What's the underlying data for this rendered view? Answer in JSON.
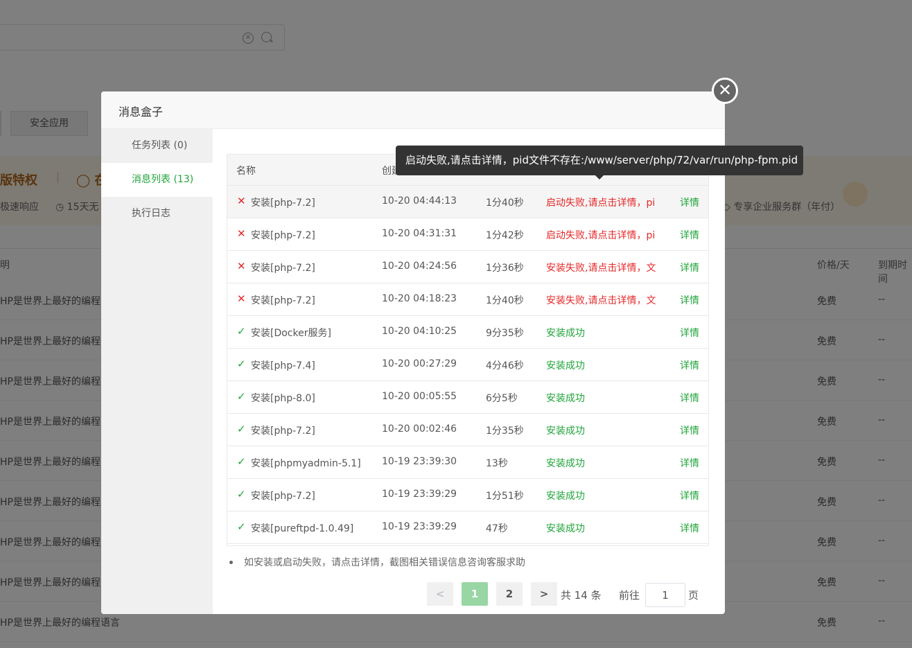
{
  "background": {
    "buttons": [
      "安全应用"
    ],
    "banner_title_1": "版特权",
    "banner_title_2": "在",
    "banner_sub": [
      "极速响应",
      "15天无",
      "专享企业服务群（年付）"
    ],
    "col_headers": {
      "desc": "明",
      "price": "价格/天",
      "expire": "到期时间"
    },
    "row_desc": "HP是世界上最好的编程",
    "row_desc_last": "HP是世界上最好的编程语言",
    "row_price": "免费",
    "row_expire": "--"
  },
  "dialog": {
    "title": "消息盒子",
    "close_icon": "close-icon",
    "sidebar": [
      {
        "label": "任务列表 (0)",
        "active": false
      },
      {
        "label": "消息列表 (13)",
        "active": true
      },
      {
        "label": "执行日志",
        "active": false
      }
    ],
    "table": {
      "headers": {
        "name": "名称",
        "created": "创建"
      },
      "rows": [
        {
          "status_icon": "error",
          "name": "安装[php-7.2]",
          "time": "10-20 04:44:13",
          "duration": "1分40秒",
          "state": "启动失败,请点击详情，pi",
          "detail": "详情"
        },
        {
          "status_icon": "error",
          "name": "安装[php-7.2]",
          "time": "10-20 04:31:31",
          "duration": "1分42秒",
          "state": "启动失败,请点击详情，pi",
          "detail": "详情"
        },
        {
          "status_icon": "error",
          "name": "安装[php-7.2]",
          "time": "10-20 04:24:56",
          "duration": "1分36秒",
          "state": "安装失败,请点击详情，文",
          "detail": "详情"
        },
        {
          "status_icon": "error",
          "name": "安装[php-7.2]",
          "time": "10-20 04:18:23",
          "duration": "1分40秒",
          "state": "安装失败,请点击详情，文",
          "detail": "详情"
        },
        {
          "status_icon": "success",
          "name": "安装[Docker服务]",
          "time": "10-20 04:10:25",
          "duration": "9分35秒",
          "state": "安装成功",
          "detail": "详情"
        },
        {
          "status_icon": "success",
          "name": "安装[php-7.4]",
          "time": "10-20 00:27:29",
          "duration": "4分46秒",
          "state": "安装成功",
          "detail": "详情"
        },
        {
          "status_icon": "success",
          "name": "安装[php-8.0]",
          "time": "10-20 00:05:55",
          "duration": "6分5秒",
          "state": "安装成功",
          "detail": "详情"
        },
        {
          "status_icon": "success",
          "name": "安装[php-7.2]",
          "time": "10-20 00:02:46",
          "duration": "1分35秒",
          "state": "安装成功",
          "detail": "详情"
        },
        {
          "status_icon": "success",
          "name": "安装[phpmyadmin-5.1]",
          "time": "10-19 23:39:30",
          "duration": "13秒",
          "state": "安装成功",
          "detail": "详情"
        },
        {
          "status_icon": "success",
          "name": "安装[php-7.2]",
          "time": "10-19 23:39:29",
          "duration": "1分51秒",
          "state": "安装成功",
          "detail": "详情"
        },
        {
          "status_icon": "success",
          "name": "安装[pureftpd-1.0.49]",
          "time": "10-19 23:39:29",
          "duration": "47秒",
          "state": "安装成功",
          "detail": "详情"
        }
      ]
    },
    "note": "如安装或启动失败，请点击详情，截图相关错误信息咨询客服求助",
    "pagination": {
      "prev_icon": "chevron-left-icon",
      "next_icon": "chevron-right-icon",
      "pages": [
        "1",
        "2"
      ],
      "current": "1",
      "total": "共 14 条",
      "goto_label": "前往",
      "goto_value": "1",
      "page_suffix": "页"
    }
  },
  "tooltip": "启动失败,请点击详情，pid文件不存在:/www/server/php/72/var/run/php-fpm.pid",
  "colors": {
    "accent": "#20a53a",
    "error": "#e62828",
    "overlay": "rgba(0,0,0,0.5)"
  }
}
